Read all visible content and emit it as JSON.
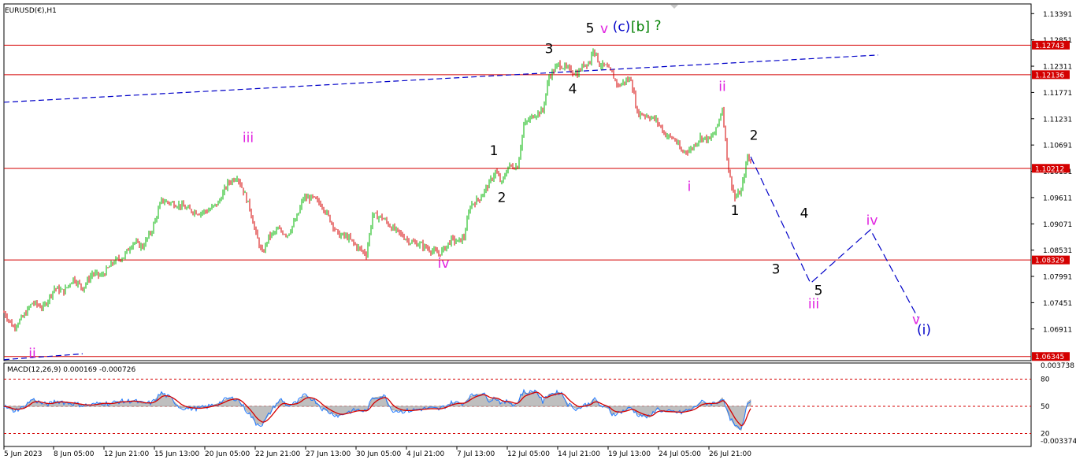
{
  "window_title": "EURUSD(€),H1",
  "chart_data": {
    "type": "candlestick",
    "title": "EURUSD(€),H1",
    "price_axis": {
      "range": [
        1.0626,
        1.1359
      ],
      "ticks": [
        "1.13391",
        "1.12851",
        "1.12311",
        "1.11771",
        "1.11231",
        "1.10691",
        "1.10151",
        "1.09611",
        "1.09071",
        "1.08531",
        "1.07991",
        "1.07451",
        "1.06911"
      ]
    },
    "time_axis": {
      "labels": [
        "5 Jun 2023",
        "8 Jun 05:00",
        "12 Jun 21:00",
        "15 Jun 13:00",
        "20 Jun 05:00",
        "22 Jun 21:00",
        "27 Jun 13:00",
        "30 Jun 05:00",
        "4 Jul 21:00",
        "7 Jul 13:00",
        "12 Jul 05:00",
        "14 Jul 21:00",
        "19 Jul 13:00",
        "24 Jul 05:00",
        "26 Jul 21:00"
      ]
    },
    "horizontal_levels": [
      {
        "value": 1.12743,
        "label": "1.12743",
        "color": "#d40000"
      },
      {
        "value": 1.12136,
        "label": "1.12136",
        "color": "#d40000"
      },
      {
        "value": 1.10212,
        "label": "1.10212",
        "color": "#d40000"
      },
      {
        "value": 1.08329,
        "label": "1.08329",
        "color": "#d40000"
      },
      {
        "value": 1.06345,
        "label": "1.06345",
        "color": "#d40000"
      }
    ],
    "price_path": [
      [
        0,
        1.0725
      ],
      [
        6,
        1.0695
      ],
      [
        12,
        1.0715
      ],
      [
        18,
        1.0745
      ],
      [
        25,
        1.0735
      ],
      [
        32,
        1.0775
      ],
      [
        38,
        1.0768
      ],
      [
        44,
        1.0795
      ],
      [
        50,
        1.0775
      ],
      [
        56,
        1.0805
      ],
      [
        62,
        1.08
      ],
      [
        70,
        1.083
      ],
      [
        76,
        1.084
      ],
      [
        82,
        1.087
      ],
      [
        88,
        1.086
      ],
      [
        94,
        1.0895
      ],
      [
        100,
        1.0955
      ],
      [
        106,
        1.095
      ],
      [
        112,
        1.0945
      ],
      [
        118,
        1.0935
      ],
      [
        124,
        1.093
      ],
      [
        130,
        1.0935
      ],
      [
        136,
        1.095
      ],
      [
        142,
        1.099
      ],
      [
        148,
        1.1005
      ],
      [
        152,
        1.0975
      ],
      [
        156,
        1.094
      ],
      [
        160,
        1.0885
      ],
      [
        164,
        1.0845
      ],
      [
        168,
        1.088
      ],
      [
        174,
        1.0895
      ],
      [
        180,
        1.0885
      ],
      [
        186,
        1.092
      ],
      [
        190,
        1.096
      ],
      [
        196,
        1.096
      ],
      [
        202,
        1.0945
      ],
      [
        208,
        1.091
      ],
      [
        212,
        1.0885
      ],
      [
        218,
        1.088
      ],
      [
        224,
        1.086
      ],
      [
        230,
        1.0845
      ],
      [
        234,
        1.0925
      ],
      [
        240,
        1.092
      ],
      [
        246,
        1.09
      ],
      [
        252,
        1.0885
      ],
      [
        258,
        1.087
      ],
      [
        264,
        1.0865
      ],
      [
        270,
        1.0855
      ],
      [
        276,
        1.0845
      ],
      [
        280,
        1.0858
      ],
      [
        284,
        1.0875
      ],
      [
        288,
        1.087
      ],
      [
        292,
        1.088
      ],
      [
        296,
        1.0945
      ],
      [
        302,
        1.096
      ],
      [
        308,
        1.099
      ],
      [
        312,
        1.1015
      ],
      [
        316,
        1.099
      ],
      [
        320,
        1.1025
      ],
      [
        326,
        1.1025
      ],
      [
        330,
        1.111
      ],
      [
        336,
        1.113
      ],
      [
        342,
        1.114
      ],
      [
        346,
        1.121
      ],
      [
        352,
        1.1235
      ],
      [
        358,
        1.1225
      ],
      [
        364,
        1.1215
      ],
      [
        368,
        1.1235
      ],
      [
        372,
        1.124
      ],
      [
        374,
        1.127
      ],
      [
        378,
        1.1235
      ],
      [
        382,
        1.123
      ],
      [
        386,
        1.1215
      ],
      [
        390,
        1.119
      ],
      [
        394,
        1.12
      ],
      [
        398,
        1.1205
      ],
      [
        402,
        1.1135
      ],
      [
        408,
        1.113
      ],
      [
        414,
        1.112
      ],
      [
        420,
        1.109
      ],
      [
        426,
        1.108
      ],
      [
        430,
        1.1055
      ],
      [
        436,
        1.106
      ],
      [
        442,
        1.1085
      ],
      [
        448,
        1.108
      ],
      [
        452,
        1.11
      ],
      [
        456,
        1.1145
      ],
      [
        460,
        1.1015
      ],
      [
        464,
        1.096
      ],
      [
        468,
        1.0975
      ],
      [
        472,
        1.1045
      ],
      [
        474,
        1.1035
      ]
    ],
    "trendline": {
      "from": [
        0,
        1.1157
      ],
      "to": [
        555,
        1.1254
      ],
      "color": "#0000c8",
      "style": "dashed"
    },
    "trendline_lower": {
      "from": [
        0,
        1.0628
      ],
      "to": [
        50,
        1.064
      ],
      "color": "#0000c8",
      "style": "dashed"
    },
    "projection": {
      "points": [
        [
          474,
          1.1045
        ],
        [
          512,
          1.0785
        ],
        [
          550,
          1.0895
        ],
        [
          580,
          1.0715
        ]
      ],
      "color": "#0000c8",
      "style": "dashed"
    },
    "wave_labels": [
      {
        "text": "ii",
        "color": "#e020e0",
        "bar": 18,
        "price": 1.0632
      },
      {
        "text": "iii",
        "color": "#e020e0",
        "bar": 155,
        "price": 1.1075
      },
      {
        "text": "iv",
        "color": "#e020e0",
        "bar": 279,
        "price": 1.0817
      },
      {
        "text": "1",
        "color": "#000000",
        "bar": 311,
        "price": 1.1048
      },
      {
        "text": "2",
        "color": "#000000",
        "bar": 316,
        "price": 1.0952
      },
      {
        "text": "3",
        "color": "#000000",
        "bar": 346,
        "price": 1.1258
      },
      {
        "text": "4",
        "color": "#000000",
        "bar": 361,
        "price": 1.1175
      },
      {
        "text": "5",
        "color": "#000000",
        "bar": 372,
        "price": 1.13
      },
      {
        "text": "v",
        "color": "#e020e0",
        "bar": 381,
        "price": 1.1299
      },
      {
        "text": "(c)",
        "color": "#0000c8",
        "bar": 392,
        "price": 1.1303
      },
      {
        "text": "[b]",
        "color": "#008000",
        "bar": 404,
        "price": 1.1303
      },
      {
        "text": "?",
        "color": "#008000",
        "bar": 415,
        "price": 1.1306
      },
      {
        "text": "ii",
        "color": "#e020e0",
        "bar": 456,
        "price": 1.118
      },
      {
        "text": "i",
        "color": "#e020e0",
        "bar": 435,
        "price": 1.0975
      },
      {
        "text": "2",
        "color": "#000000",
        "bar": 476,
        "price": 1.108
      },
      {
        "text": "1",
        "color": "#000000",
        "bar": 464,
        "price": 1.0925
      },
      {
        "text": "4",
        "color": "#000000",
        "bar": 508,
        "price": 1.092
      },
      {
        "text": "iv",
        "color": "#e020e0",
        "bar": 551,
        "price": 1.0905
      },
      {
        "text": "3",
        "color": "#000000",
        "bar": 490,
        "price": 1.0805
      },
      {
        "text": "5",
        "color": "#000000",
        "bar": 517,
        "price": 1.0761
      },
      {
        "text": "iii",
        "color": "#e020e0",
        "bar": 514,
        "price": 1.0734
      },
      {
        "text": "v",
        "color": "#e020e0",
        "bar": 579,
        "price": 1.0701
      },
      {
        "text": "(i)",
        "color": "#0000c8",
        "bar": 584,
        "price": 1.068
      }
    ],
    "bullish_color": "#00b400",
    "bearish_color": "#d40000",
    "macd": {
      "label": "MACD(12,26,9) 0.000169 -0.000726",
      "axis_ticks": [
        "0.003738",
        "80",
        "50",
        "20",
        "-0.003374"
      ],
      "levels": [
        80,
        50,
        20
      ],
      "histogram_color": "#b4b4b4",
      "signal_color": "#d40000",
      "fast_color": "#1e78ff"
    }
  }
}
